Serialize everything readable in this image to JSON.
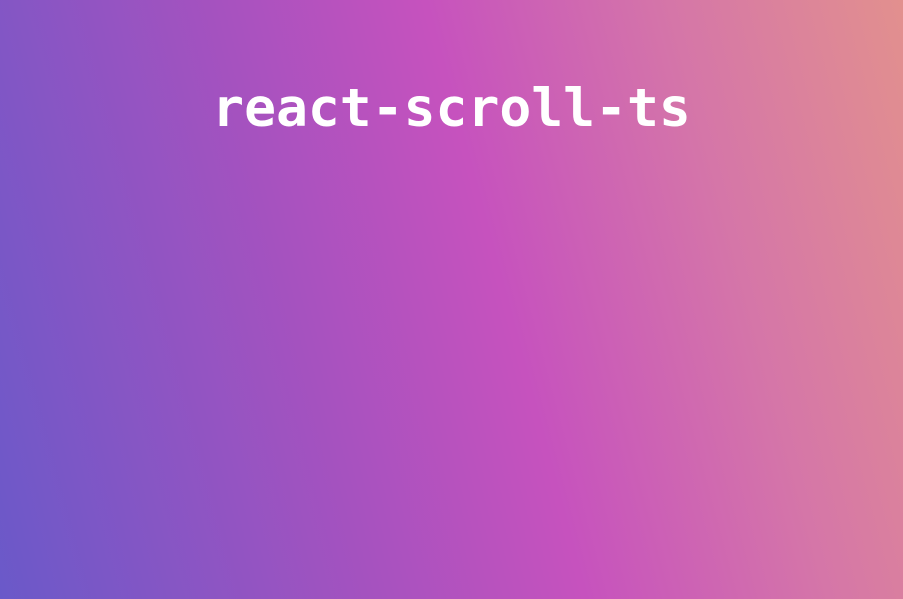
{
  "hero": {
    "title": "react-scroll-ts"
  },
  "colors": {
    "gradient_start": "#6a59c9",
    "gradient_mid": "#c652be",
    "gradient_end": "#e2908e",
    "title_text": "#ffffff"
  }
}
